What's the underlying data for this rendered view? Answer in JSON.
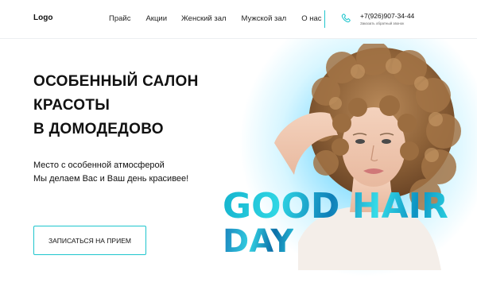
{
  "header": {
    "logo": "Logo",
    "nav": [
      "Прайс",
      "Акции",
      "Женский зал",
      "Мужской зал",
      "О нас"
    ],
    "phone": "+7(926)907-34-44",
    "callback": "Заказать обратный звонок"
  },
  "hero": {
    "title_lines": [
      "ОСОБЕННЫЙ САЛОН",
      "КРАСОТЫ",
      "В ДОМОДЕДОВО"
    ],
    "subtitle_lines": [
      "Место с особенной атмосферой",
      "Мы делаем Вас и Ваш день красивее!"
    ],
    "cta": "ЗАПИСАТЬСЯ НА ПРИЕМ",
    "headline_1": "GOOD HAIR",
    "headline_2": "DAY"
  },
  "colors": {
    "accent": "#1fc5cd",
    "glow": "#5fd0ff"
  },
  "icons": {
    "phone": "phone-icon"
  }
}
